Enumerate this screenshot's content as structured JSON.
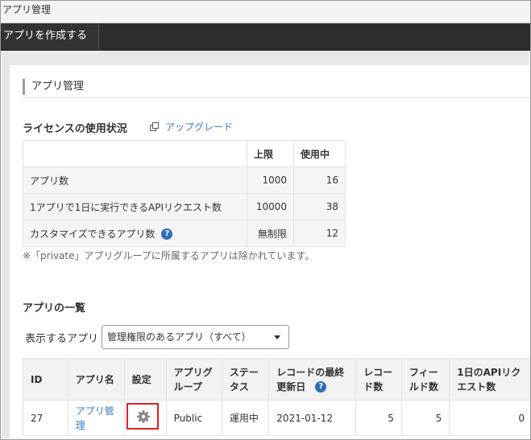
{
  "window": {
    "title": "アプリ管理"
  },
  "toolbar": {
    "create_app_label": "アプリを作成する"
  },
  "page": {
    "title": "アプリ管理"
  },
  "license": {
    "section_title": "ライセンスの使用状況",
    "upgrade_link": "アップグレード",
    "headers": {
      "limit": "上限",
      "in_use": "使用中"
    },
    "rows": [
      {
        "label": "アプリ数",
        "limit": "1000",
        "in_use": "16"
      },
      {
        "label": "1アプリで1日に実行できるAPIリクエスト数",
        "limit": "10000",
        "in_use": "38"
      },
      {
        "label": "カスタマイズできるアプリ数",
        "limit": "無制限",
        "in_use": "12"
      }
    ],
    "help_glyph": "?",
    "note": "※「private」アプリグループに所属するアプリは除かれています。"
  },
  "apps": {
    "section_title": "アプリの一覧",
    "filter_label": "表示するアプリ",
    "filter_value": "管理権限のあるアプリ（すべて）",
    "columns": [
      "ID",
      "アプリ名",
      "設定",
      "アプリグループ",
      "ステータス",
      "レコードの最終更新日",
      "レコード数",
      "フィールド数",
      "1日のAPIリクエスト数"
    ],
    "help_glyph": "?",
    "rows": [
      {
        "id": "27",
        "name": "アプリ管理",
        "group": "Public",
        "status": "運用中",
        "last_updated": "2021-01-12",
        "records": "5",
        "fields": "5",
        "api_requests": "0"
      }
    ]
  },
  "icons": {
    "settings": "gear-icon",
    "upgrade": "external-window-icon",
    "help": "help-circle-icon",
    "dropdown": "chevron-down-icon"
  },
  "colors": {
    "link": "#3a7ac0",
    "highlight_border": "#e02020",
    "help_icon": "#2f6fb7",
    "toolbar": "#2d2d2d"
  }
}
